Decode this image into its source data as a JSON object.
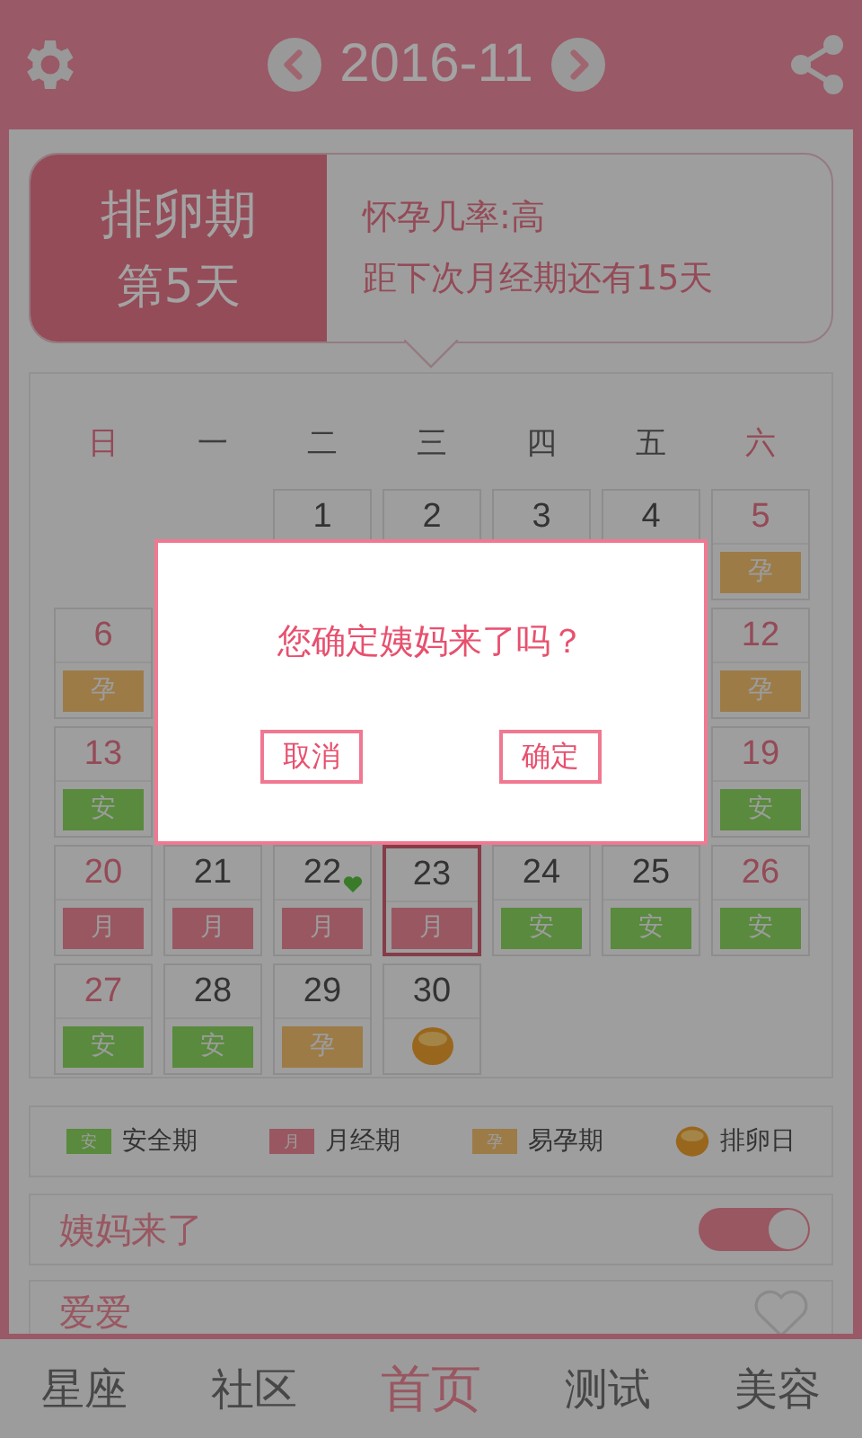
{
  "header": {
    "title": "2016-11"
  },
  "status_card": {
    "phase": "排卵期",
    "day": "第5天",
    "lines": [
      "怀孕几率:高",
      "距下次月经期还有15天"
    ]
  },
  "calendar": {
    "weekdays": [
      {
        "label": "日",
        "weekend": true
      },
      {
        "label": "一",
        "weekend": false
      },
      {
        "label": "二",
        "weekend": false
      },
      {
        "label": "三",
        "weekend": false
      },
      {
        "label": "四",
        "weekend": false
      },
      {
        "label": "五",
        "weekend": false
      },
      {
        "label": "六",
        "weekend": true
      }
    ],
    "weeks": [
      [
        {
          "kind": "blank"
        },
        {
          "kind": "blank"
        },
        {
          "kind": "plain",
          "day": "1",
          "selected": false,
          "heart": false
        },
        {
          "kind": "plain",
          "day": "2",
          "selected": false,
          "heart": false
        },
        {
          "kind": "plain",
          "day": "3",
          "selected": false,
          "heart": false
        },
        {
          "kind": "plain",
          "day": "4",
          "selected": false,
          "heart": false
        },
        {
          "kind": "fertile",
          "day": "5",
          "tag": "孕",
          "selected": false,
          "heart": false
        }
      ],
      [
        {
          "kind": "fertile",
          "day": "6",
          "tag": "孕",
          "selected": false,
          "heart": false
        },
        {
          "kind": "blank"
        },
        {
          "kind": "blank"
        },
        {
          "kind": "blank"
        },
        {
          "kind": "blank"
        },
        {
          "kind": "blank"
        },
        {
          "kind": "fertile",
          "day": "12",
          "tag": "孕",
          "selected": false,
          "heart": false
        }
      ],
      [
        {
          "kind": "safe",
          "day": "13",
          "tag": "安",
          "selected": false,
          "heart": false
        },
        {
          "kind": "blank"
        },
        {
          "kind": "blank"
        },
        {
          "kind": "blank"
        },
        {
          "kind": "blank"
        },
        {
          "kind": "blank"
        },
        {
          "kind": "safe",
          "day": "19",
          "tag": "安",
          "selected": false,
          "heart": false
        }
      ],
      [
        {
          "kind": "period",
          "day": "20",
          "tag": "月",
          "selected": false,
          "heart": false
        },
        {
          "kind": "period",
          "day": "21",
          "tag": "月",
          "selected": false,
          "heart": false
        },
        {
          "kind": "period",
          "day": "22",
          "tag": "月",
          "selected": false,
          "heart": true
        },
        {
          "kind": "period",
          "day": "23",
          "tag": "月",
          "selected": true,
          "heart": false
        },
        {
          "kind": "safe",
          "day": "24",
          "tag": "安",
          "selected": false,
          "heart": false
        },
        {
          "kind": "safe",
          "day": "25",
          "tag": "安",
          "selected": false,
          "heart": false
        },
        {
          "kind": "safe",
          "day": "26",
          "tag": "安",
          "selected": false,
          "heart": false
        }
      ],
      [
        {
          "kind": "safe",
          "day": "27",
          "tag": "安",
          "selected": false,
          "heart": false
        },
        {
          "kind": "safe",
          "day": "28",
          "tag": "安",
          "selected": false,
          "heart": false
        },
        {
          "kind": "fertile",
          "day": "29",
          "tag": "孕",
          "selected": false,
          "heart": false
        },
        {
          "kind": "ovulation",
          "day": "30",
          "selected": false,
          "heart": false
        },
        {
          "kind": "blank"
        },
        {
          "kind": "blank"
        },
        {
          "kind": "blank"
        }
      ]
    ]
  },
  "legend": [
    {
      "kind": "safe",
      "mark": "安",
      "label": "安全期"
    },
    {
      "kind": "period",
      "mark": "月",
      "label": "月经期"
    },
    {
      "kind": "fertile",
      "mark": "孕",
      "label": "易孕期"
    },
    {
      "kind": "ovulation",
      "label": "排卵日"
    }
  ],
  "period_toggle": {
    "label": "姨妈来了",
    "on": true
  },
  "love_row": {
    "label": "爱爱",
    "liked": false
  },
  "nav": [
    {
      "label": "星座",
      "selected": false
    },
    {
      "label": "社区",
      "selected": false
    },
    {
      "label": "首页",
      "selected": true
    },
    {
      "label": "测试",
      "selected": false
    },
    {
      "label": "美容",
      "selected": false
    }
  ],
  "dialog": {
    "message": "您确定姨妈来了吗？",
    "buttons": [
      "取消",
      "确定"
    ]
  }
}
